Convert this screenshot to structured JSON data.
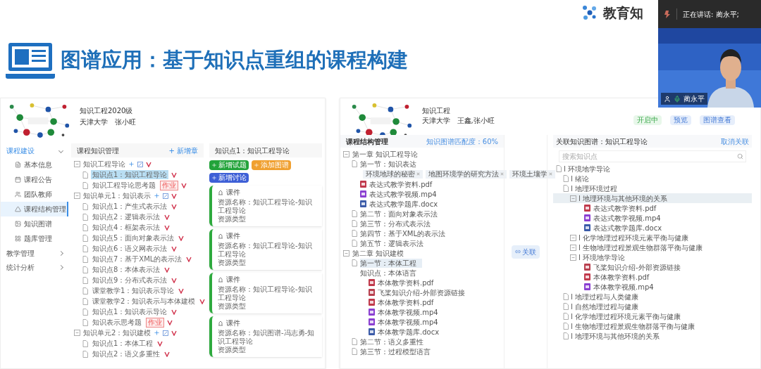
{
  "slide": {
    "brand": "教育知",
    "title": "图谱应用：基于知识点重组的课程构建"
  },
  "video_call": {
    "speaker_label": "正在讲话: 蔺永平;",
    "name": "蔺永平"
  },
  "left_screen": {
    "course_title": "知识工程2020级",
    "course_meta": "天津大学   张小旺",
    "sidebar": [
      {
        "label": "课程建设",
        "expanded": true,
        "children": [
          {
            "label": "基本信息",
            "selected": false
          },
          {
            "label": "课程公告",
            "selected": false
          },
          {
            "label": "团队教师",
            "selected": false
          },
          {
            "label": "课程结构管理",
            "selected": true
          },
          {
            "label": "知识图谱",
            "selected": false
          },
          {
            "label": "题库管理",
            "selected": false
          }
        ]
      },
      {
        "label": "教学管理",
        "expanded": false
      },
      {
        "label": "统计分析",
        "expanded": false
      }
    ],
    "tree_panel": {
      "title": "课程知识管理",
      "action": "+ 新增章",
      "nodes": [
        {
          "label": "知识工程导论",
          "expanded": true,
          "children": [
            {
              "label": "知识点1：知识工程导论",
              "selected": true
            },
            {
              "label": "知识工程导论思考题",
              "badge": "作业",
              "selected": false
            }
          ]
        },
        {
          "label": "知识单元1：知识表示",
          "expanded": true,
          "children": [
            {
              "label": "知识点1：产生式表示法",
              "selected": false
            },
            {
              "label": "知识点2：逻辑表示法",
              "selected": false
            },
            {
              "label": "知识点4：框架表示法",
              "selected": false
            },
            {
              "label": "知识点5：面向对象表示法",
              "selected": false
            },
            {
              "label": "知识点6：语义网表示法",
              "selected": false
            },
            {
              "label": "知识点7：基于XML的表示法",
              "selected": false
            },
            {
              "label": "知识点8：本体表示法",
              "selected": false
            },
            {
              "label": "知识点9：分布式表示法",
              "selected": false
            },
            {
              "label": "课堂教学1：知识表示导论",
              "selected": false
            },
            {
              "label": "课堂教学2：知识表示与本体建模",
              "selected": false
            },
            {
              "label": "知识点1：知识表示导论",
              "selected": false
            },
            {
              "label": "知识表示思考题",
              "badge": "作业",
              "selected": false
            }
          ]
        },
        {
          "label": "知识单元2：知识建模",
          "expanded": true,
          "children": [
            {
              "label": "知识点1：本体工程",
              "selected": false
            },
            {
              "label": "知识点2：语义多重性",
              "selected": false
            }
          ]
        }
      ]
    },
    "detail_panel": {
      "title": "知识点1：知识工程导论",
      "buttons": [
        {
          "label": "新增试题",
          "color": "#22a33a"
        },
        {
          "label": "添加图谱",
          "color": "#f0a030"
        },
        {
          "label": "新增讨论",
          "color": "#3d5fd6"
        }
      ],
      "cards": [
        {
          "type": "课件",
          "name": "资源名称：知识工程导论-知识工程导论",
          "type_label": "资源类型"
        },
        {
          "type": "课件",
          "name": "资源名称：知识工程导论-知识工程导论",
          "type_label": "资源类型"
        },
        {
          "type": "课件",
          "name": "资源名称：知识工程导论-知识工程导论",
          "type_label": "资源类型"
        },
        {
          "type": "课件",
          "name": "资源名称：知识图谱-冯志勇-知识工程导论",
          "type_label": "资源类型"
        }
      ]
    }
  },
  "right_screen": {
    "course_title": "知识工程",
    "course_meta": "天津大学   王鑫,张小旺",
    "top_buttons": [
      {
        "label": "开启中",
        "kind": "status"
      },
      {
        "label": "预览",
        "kind": "action"
      },
      {
        "label": "图谱查看",
        "kind": "action"
      }
    ],
    "structure_panel": {
      "title": "课程结构管理",
      "match": "知识图谱匹配度：60%",
      "nodes": [
        {
          "kind": "chapter",
          "label": "第一章  知识工程导论",
          "selected": false,
          "children": [
            {
              "kind": "section",
              "label": "第一节：知识表达",
              "selected": false,
              "children": [
                {
                  "kind": "tags",
                  "tags": [
                    "环境地球的秘密",
                    "地图环境学的研究方法",
                    "环境土壤学"
                  ]
                },
                {
                  "kind": "file",
                  "color": "#c0394b",
                  "label": "表达式教学资料.pdf",
                  "selected": false
                },
                {
                  "kind": "file",
                  "color": "#8a3fd1",
                  "label": "表达式教学视频.mp4",
                  "selected": false
                },
                {
                  "kind": "file",
                  "color": "#3b5ba8",
                  "label": "表达式教学题库.docx",
                  "selected": false
                }
              ]
            },
            {
              "kind": "section",
              "label": "第二节：面向对象表示法",
              "selected": false
            },
            {
              "kind": "section",
              "label": "第三节：分布式表示法",
              "selected": false
            },
            {
              "kind": "section",
              "label": "第四节：基于XML的表示法",
              "selected": false
            },
            {
              "kind": "section",
              "label": "第五节：逻辑表示法",
              "selected": false
            }
          ]
        },
        {
          "kind": "chapter",
          "label": "第二章  知识建模",
          "selected": false,
          "children": [
            {
              "kind": "section",
              "label": "第一节：本体工程",
              "selected": true,
              "children": [
                {
                  "kind": "point",
                  "label": "知识点：本体语言",
                  "selected": false,
                  "children": [
                    {
                      "kind": "file",
                      "color": "#c0394b",
                      "label": "本体教学资料.pdf",
                      "selected": false
                    },
                    {
                      "kind": "file",
                      "color": "#b8404f",
                      "label": "飞桨知识介绍-外部资源链接",
                      "selected": false
                    },
                    {
                      "kind": "file",
                      "color": "#c0394b",
                      "label": "本体教学资料.pdf",
                      "selected": false
                    },
                    {
                      "kind": "file",
                      "color": "#8a3fd1",
                      "label": "本体教学视频.mp4",
                      "selected": false
                    },
                    {
                      "kind": "file",
                      "color": "#8a3fd1",
                      "label": "本体教学视频.mp4",
                      "selected": false
                    },
                    {
                      "kind": "file",
                      "color": "#3b5ba8",
                      "label": "本体教学题库.docx",
                      "selected": false
                    }
                  ]
                }
              ]
            },
            {
              "kind": "section",
              "label": "第二节：语义多重性",
              "selected": false
            },
            {
              "kind": "section",
              "label": "第三节：过程模型语言",
              "selected": false
            }
          ]
        }
      ]
    },
    "link_button": "关联",
    "graph_panel": {
      "title": "关联知识图谱：知识工程导论",
      "action": "取消关联",
      "search": {
        "placeholder": "搜索知识点"
      },
      "nodes": [
        {
          "kind": "doc",
          "label": "环境地学导论",
          "selected": false,
          "children": [
            {
              "kind": "doc",
              "label": "绪论",
              "selected": false
            },
            {
              "kind": "doc",
              "label": "地理环境过程",
              "selected": false,
              "children": [
                {
                  "kind": "folder",
                  "label": "地理环境与其他环境的关系",
                  "selected": true,
                  "children": [
                    {
                      "kind": "file",
                      "color": "#c0394b",
                      "label": "表达式教学资料.pdf",
                      "selected": false
                    },
                    {
                      "kind": "file",
                      "color": "#8a3fd1",
                      "label": "表达式教学视频.mp4",
                      "selected": false
                    },
                    {
                      "kind": "file",
                      "color": "#3b5ba8",
                      "label": "表达式教学题库.docx",
                      "selected": false
                    }
                  ]
                },
                {
                  "kind": "folder",
                  "label": "化学地理过程环境元素平衡与健康",
                  "selected": false
                },
                {
                  "kind": "folder",
                  "label": "生物地理过程景观生物群落平衡与健康",
                  "selected": false
                },
                {
                  "kind": "folder",
                  "label": "环境地学导论",
                  "selected": false,
                  "children": [
                    {
                      "kind": "file",
                      "color": "#b8404f",
                      "label": "飞桨知识介绍-外部资源链接",
                      "selected": false
                    },
                    {
                      "kind": "file",
                      "color": "#c0394b",
                      "label": "本体教学资料.pdf",
                      "selected": false
                    },
                    {
                      "kind": "file",
                      "color": "#8a3fd1",
                      "label": "本体教学视频.mp4",
                      "selected": false
                    }
                  ]
                }
              ]
            },
            {
              "kind": "doc",
              "label": "地理过程与人类健康",
              "selected": false
            },
            {
              "kind": "doc",
              "label": "自然地理过程与健康",
              "selected": false
            },
            {
              "kind": "doc",
              "label": "化学地理过程环境元素平衡与健康",
              "selected": false
            },
            {
              "kind": "doc",
              "label": "生物地理过程景观生物群落平衡与健康",
              "selected": false
            },
            {
              "kind": "doc",
              "label": "地理环境与其他环境的关系",
              "selected": false
            }
          ]
        }
      ]
    }
  }
}
